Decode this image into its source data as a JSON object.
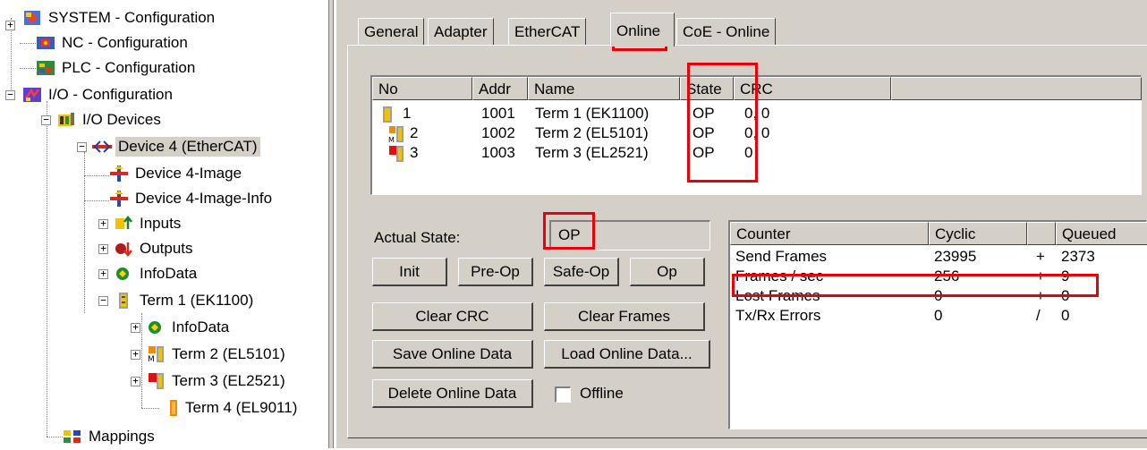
{
  "tree": {
    "system": "SYSTEM - Configuration",
    "nc": "NC - Configuration",
    "plc": "PLC - Configuration",
    "io": "I/O - Configuration",
    "io_devices": "I/O Devices",
    "device4": "Device 4 (EtherCAT)",
    "device4_image": "Device 4-Image",
    "device4_image_info": "Device 4-Image-Info",
    "inputs": "Inputs",
    "outputs": "Outputs",
    "infodata": "InfoData",
    "term1": "Term 1 (EK1100)",
    "term1_infodata": "InfoData",
    "term2": "Term 2 (EL5101)",
    "term3": "Term 3 (EL2521)",
    "term4": "Term 4 (EL9011)",
    "mappings": "Mappings"
  },
  "tabs": [
    "General",
    "Adapter",
    "EtherCAT",
    "Online",
    "CoE - Online"
  ],
  "device_table": {
    "headers": [
      "No",
      "Addr",
      "Name",
      "State",
      "CRC"
    ],
    "rows": [
      {
        "no": "1",
        "addr": "1001",
        "name": "Term 1 (EK1100)",
        "state": "OP",
        "crc": "0, 0"
      },
      {
        "no": "2",
        "addr": "1002",
        "name": "Term 2 (EL5101)",
        "state": "OP",
        "crc": "0, 0"
      },
      {
        "no": "3",
        "addr": "1003",
        "name": "Term 3 (EL2521)",
        "state": "OP",
        "crc": "0"
      }
    ]
  },
  "state": {
    "label": "Actual State:",
    "value": "OP"
  },
  "buttons": {
    "init": "Init",
    "preop": "Pre-Op",
    "safeop": "Safe-Op",
    "op": "Op",
    "clear_crc": "Clear CRC",
    "clear_frames": "Clear Frames",
    "save_online": "Save Online Data",
    "load_online": "Load Online Data...",
    "delete_online": "Delete Online Data",
    "offline": "Offline"
  },
  "counter_table": {
    "headers": [
      "Counter",
      "Cyclic",
      "",
      "Queued"
    ],
    "rows": [
      {
        "counter": "Send Frames",
        "cyclic": "23995",
        "op": "+",
        "queued": "2373"
      },
      {
        "counter": "Frames / sec",
        "cyclic": "256",
        "op": "+",
        "queued": "9"
      },
      {
        "counter": "Lost Frames",
        "cyclic": "0",
        "op": "+",
        "queued": "0"
      },
      {
        "counter": "Tx/Rx Errors",
        "cyclic": "0",
        "op": "/",
        "queued": "0"
      }
    ]
  },
  "colors": {
    "highlight": "#e8000b",
    "window_bg": "#d4d0c8"
  }
}
